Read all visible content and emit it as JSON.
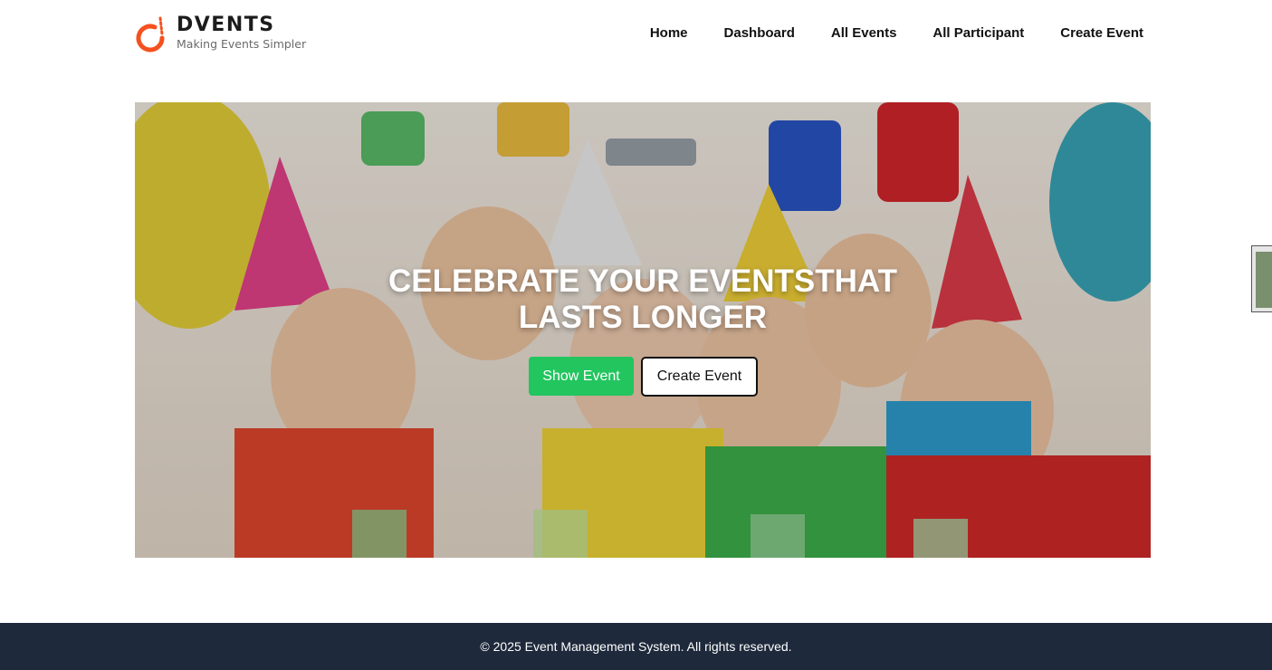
{
  "brand": {
    "name": "DVENTS",
    "tagline": "Making Events Simpler",
    "accent_color": "#f4511e"
  },
  "nav": {
    "items": [
      {
        "label": "Home"
      },
      {
        "label": "Dashboard"
      },
      {
        "label": "All Events"
      },
      {
        "label": "All Participant"
      },
      {
        "label": "Create Event"
      }
    ]
  },
  "hero": {
    "title": "CELEBRATE YOUR EVENTSTHAT LASTS LONGER",
    "show_button_label": "Show Event",
    "create_button_label": "Create Event",
    "show_button_color": "#22c55e",
    "image_subject": "party-kids-photo"
  },
  "footer": {
    "text": "© 2025 Event Management System. All rights reserved.",
    "background_color": "#1e293b"
  }
}
